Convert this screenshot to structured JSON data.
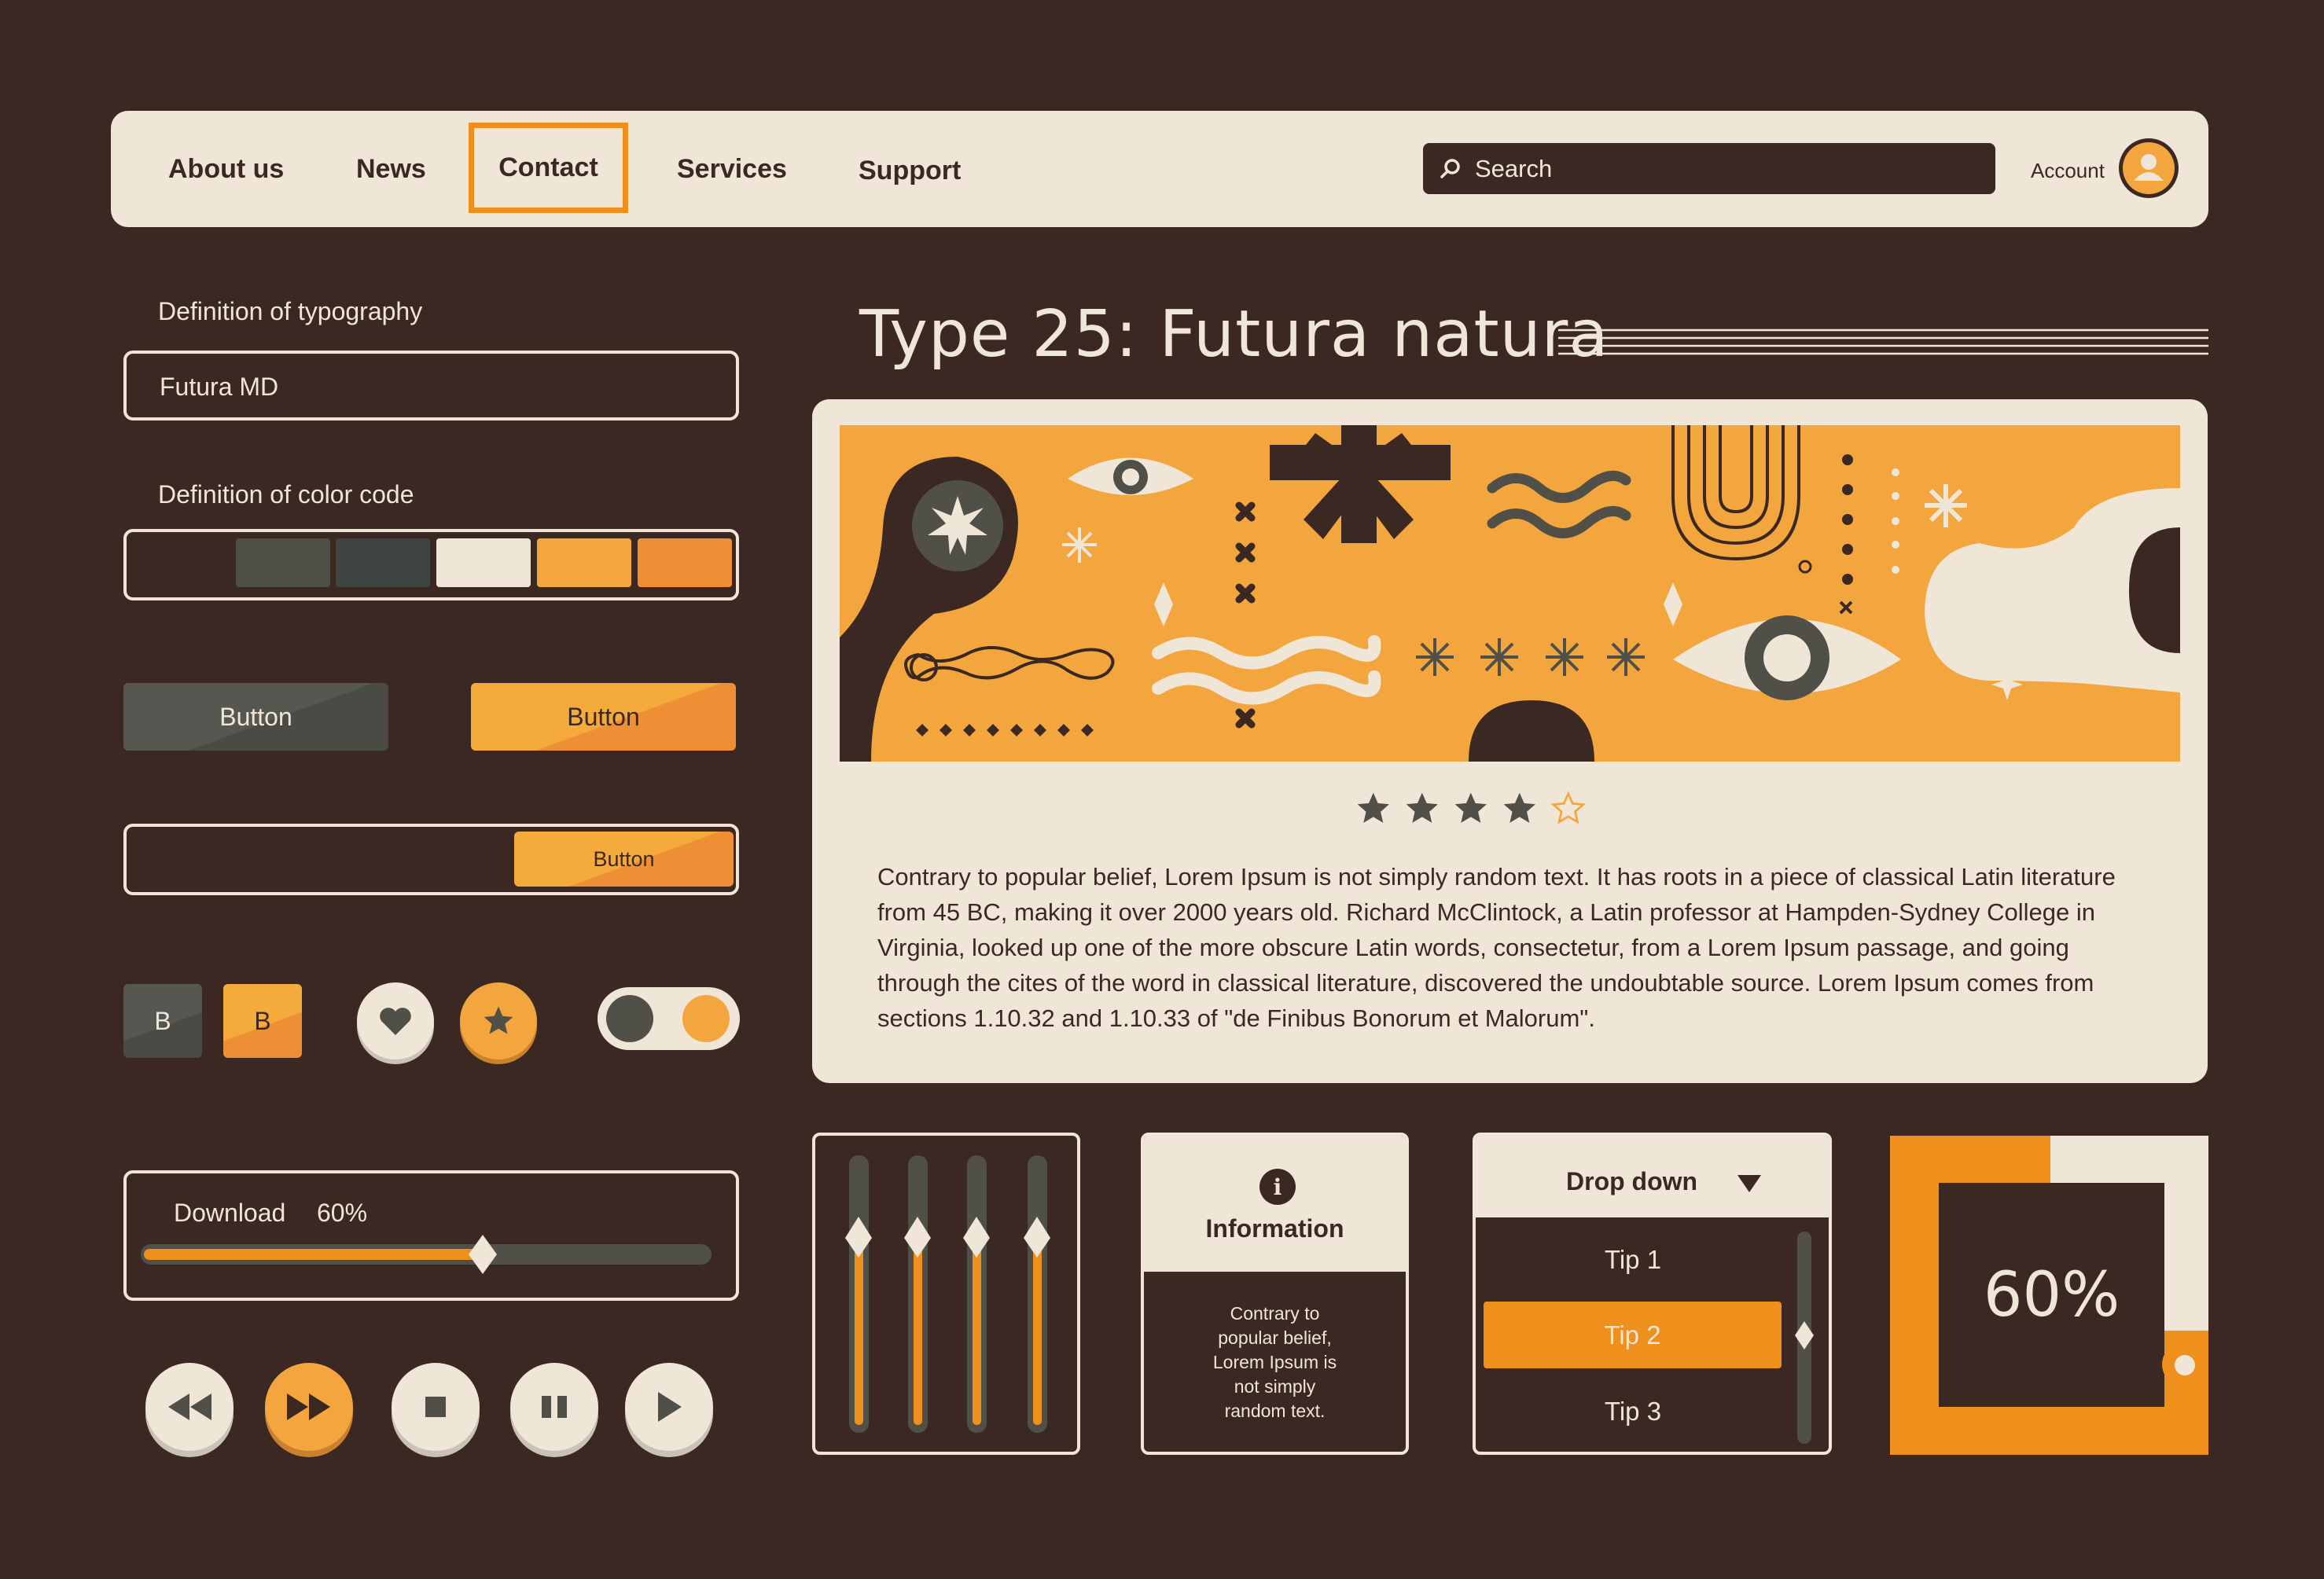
{
  "nav": {
    "items": [
      "About us",
      "News",
      "Contact",
      "Services",
      "Support"
    ],
    "search_placeholder": "Search",
    "account_label": "Account"
  },
  "left": {
    "typography_label": "Definition of typography",
    "typography_value": "Futura MD",
    "color_label": "Definition of color code",
    "color_swatches": [
      "#3b2823",
      "#505049",
      "#3e4542",
      "#f0e6d8",
      "#f2a63d",
      "#ef8f35"
    ],
    "button_gray": "Button",
    "button_orange": "Button",
    "button_inline": "Button",
    "square_btn_1": "B",
    "square_btn_2": "B",
    "download_label": "Download",
    "download_percent": "60%",
    "download_progress": 0.6
  },
  "main": {
    "title": "Type 25: Futura natura",
    "rating": 4,
    "rating_max": 5,
    "paragraph": "Contrary to popular belief, Lorem Ipsum is not simply random text. It has roots in a piece of classical Latin literature from 45 BC, making it over 2000 years old. Richard McClintock, a Latin professor at Hampden-Sydney College in Virginia, looked up one of the more obscure Latin words, consectetur, from a Lorem Ipsum passage, and going through the cites of the word in classical literature, discovered the undoubtable source. Lorem Ipsum comes from sections 1.10.32 and 1.10.33 of \"de Finibus Bonorum et Malorum\"."
  },
  "widgets": {
    "info_title": "Information",
    "info_text": "Contrary to popular belief, Lorem Ipsum is not simply random text.",
    "dropdown_title": "Drop down",
    "dropdown_items": [
      "Tip 1",
      "Tip 2",
      "Tip 3"
    ],
    "dropdown_selected": "Tip 2",
    "progress_percent": "60%"
  },
  "colors": {
    "background": "#3b2823",
    "cream": "#f0e6d8",
    "orange": "#ef8f1c",
    "light_orange": "#f2a63d",
    "gray": "#505049"
  }
}
